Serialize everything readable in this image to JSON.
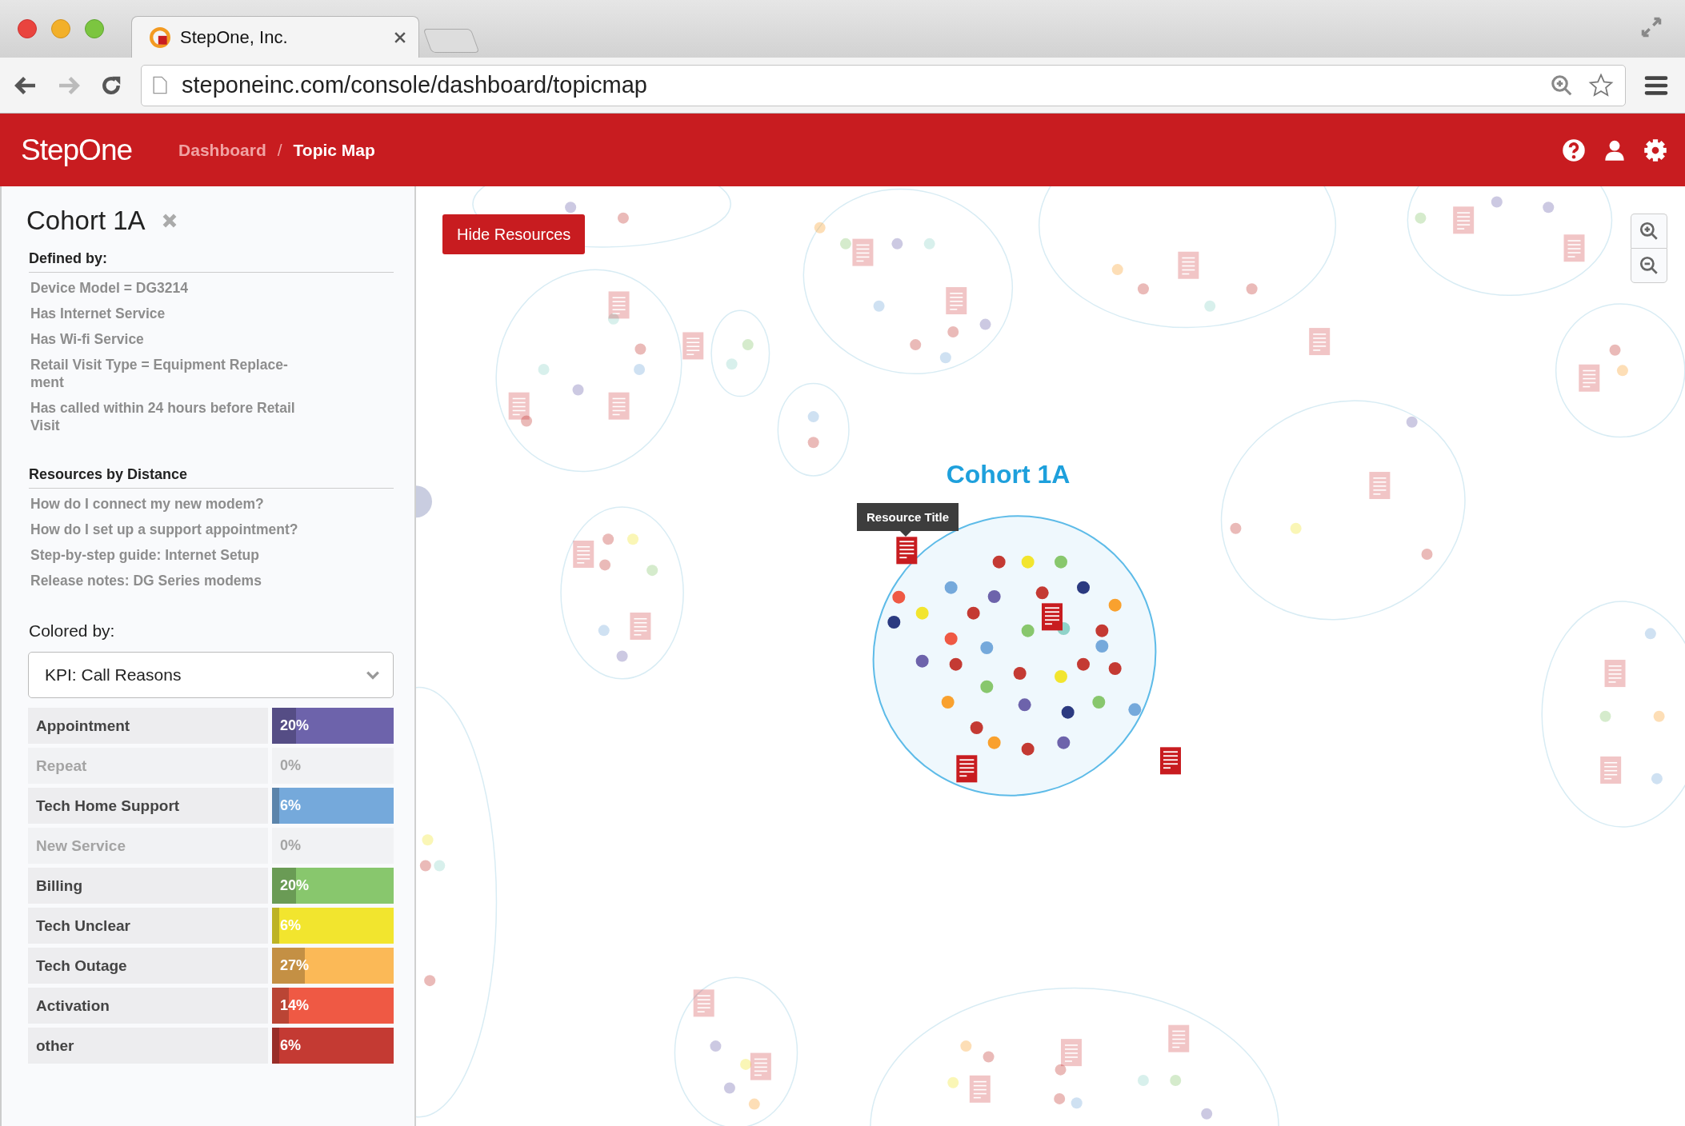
{
  "browser": {
    "tab_title": "StepOne, Inc.",
    "url": "steponeinc.com/console/dashboard/topicmap"
  },
  "header": {
    "logo": "StepOne",
    "separator": "/",
    "breadcrumb": [
      {
        "label": "Dashboard",
        "selected": false
      },
      {
        "label": "Topic Map",
        "selected": true
      }
    ]
  },
  "sidebar": {
    "title": "Cohort 1A",
    "defined_by": {
      "heading": "Defined by:",
      "items": [
        "Device Model = DG3214",
        "Has Internet Service",
        "Has Wi-fi Service",
        "Retail Visit Type = Equipment Replace-\nment",
        "Has called within 24 hours before Retail\nVisit"
      ]
    },
    "resources": {
      "heading": "Resources by Distance",
      "items": [
        "How do I connect my new modem?",
        "How do I set up a support appointment?",
        "Step-by-step guide: Internet Setup",
        "Release notes: DG Series modems"
      ]
    },
    "colored_by": {
      "label": "Colored by:",
      "value": "KPI: Call Reasons"
    },
    "legend": [
      {
        "label": "Appointment",
        "value": "20%",
        "level": 0.2,
        "disabled": false,
        "color": "#6d63ab"
      },
      {
        "label": "Repeat",
        "value": "0%",
        "disabled": true
      },
      {
        "label": "Tech Home Support",
        "value": "6%",
        "level": 0.06,
        "disabled": false,
        "color": "#75a9db"
      },
      {
        "label": "New Service",
        "value": "0%",
        "disabled": true
      },
      {
        "label": "Billing",
        "value": "20%",
        "level": 0.2,
        "disabled": false,
        "color": "#88c76d"
      },
      {
        "label": "Tech Unclear",
        "value": "6%",
        "level": 0.06,
        "disabled": false,
        "color": "#f2e52e"
      },
      {
        "label": "Tech Outage",
        "value": "27%",
        "level": 0.27,
        "disabled": false,
        "color": "#fbb957"
      },
      {
        "label": "Activation",
        "value": "14%",
        "level": 0.14,
        "disabled": false,
        "color": "#ef5944"
      },
      {
        "label": "other",
        "value": "6%",
        "level": 0.06,
        "disabled": false,
        "color": "#c43a33"
      }
    ]
  },
  "map": {
    "button": "Hide Resources",
    "cluster_label": "Cohort 1A",
    "tooltip": "Resource Title"
  }
}
